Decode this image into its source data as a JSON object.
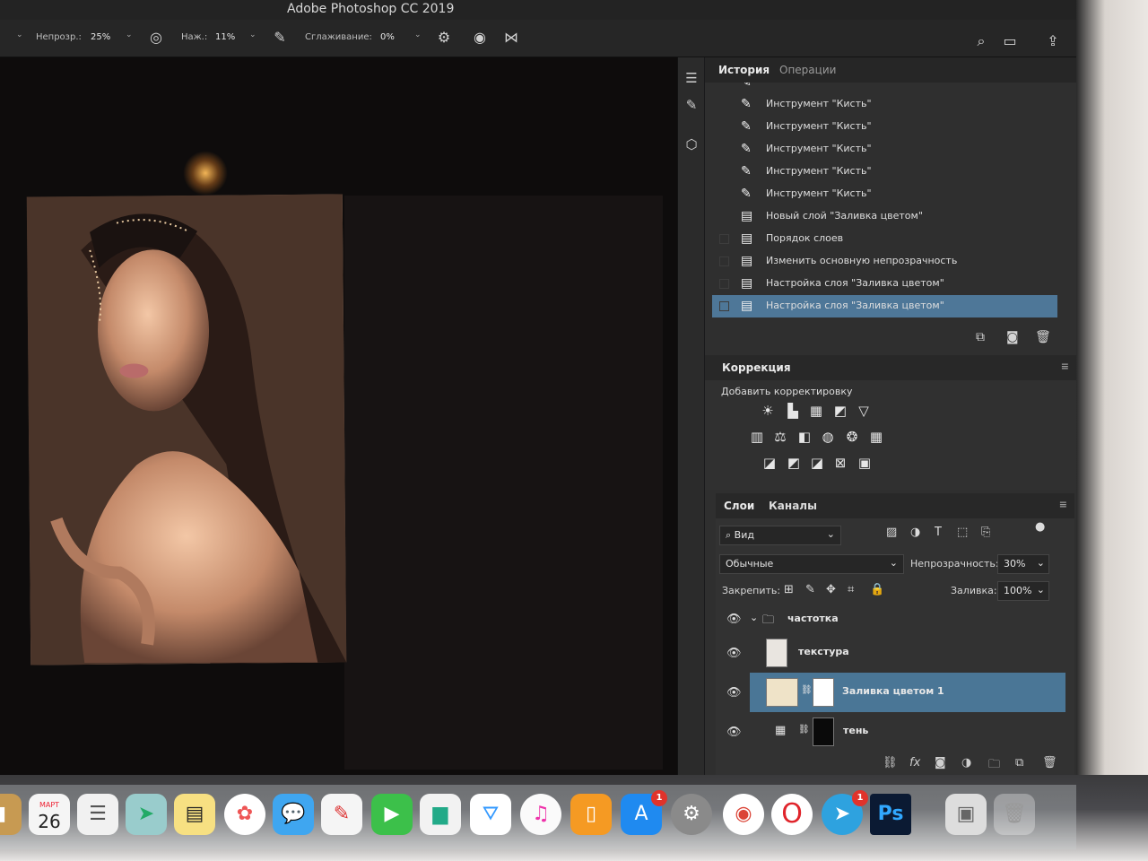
{
  "window": {
    "title": "Adobe Photoshop CC 2019"
  },
  "options_bar": {
    "opacity_label": "Непрозр.:",
    "opacity_value": "25%",
    "pressure_label": "Наж.:",
    "pressure_value": "11%",
    "smoothing_label": "Сглаживание:",
    "smoothing_value": "0%"
  },
  "history_panel": {
    "tabs": [
      {
        "label": "История",
        "active": true
      },
      {
        "label": "Операции",
        "active": false
      }
    ],
    "items": [
      {
        "label": "Инструмент \"Кисть\"",
        "icon": "brush-icon"
      },
      {
        "label": "Инструмент \"Кисть\"",
        "icon": "brush-icon"
      },
      {
        "label": "Инструмент \"Кисть\"",
        "icon": "brush-icon"
      },
      {
        "label": "Инструмент \"Кисть\"",
        "icon": "brush-icon"
      },
      {
        "label": "Инструмент \"Кисть\"",
        "icon": "brush-icon"
      },
      {
        "label": "Инструмент \"Кисть\"",
        "icon": "brush-icon"
      },
      {
        "label": "Новый слой \"Заливка цветом\"",
        "icon": "document-icon"
      },
      {
        "label": "Порядок слоев",
        "icon": "document-icon"
      },
      {
        "label": "Изменить основную непрозрачность",
        "icon": "document-icon"
      },
      {
        "label": "Настройка слоя \"Заливка цветом\"",
        "icon": "document-icon"
      },
      {
        "label": "Настройка слоя \"Заливка цветом\"",
        "icon": "document-icon",
        "selected": true
      }
    ]
  },
  "adjustments_panel": {
    "title": "Коррекция",
    "add_label": "Добавить корректировку"
  },
  "layers_panel": {
    "tabs": [
      {
        "label": "Слои",
        "active": true
      },
      {
        "label": "Каналы",
        "active": false
      }
    ],
    "filter_value": "Вид",
    "blend_mode": "Обычные",
    "opacity_label": "Непрозрачность:",
    "opacity_value": "30%",
    "lock_label": "Закрепить:",
    "fill_label": "Заливка:",
    "fill_value": "100%",
    "layers": [
      {
        "name": "частотка",
        "type": "group",
        "visible": true
      },
      {
        "name": "текстура",
        "type": "pixel",
        "visible": true
      },
      {
        "name": "Заливка цветом 1",
        "type": "fill",
        "visible": true,
        "selected": true,
        "fill_color": "#efe3c8"
      },
      {
        "name": "тень",
        "type": "adjustment",
        "visible": true
      }
    ]
  },
  "dock": {
    "calendar_month": "МАРТ",
    "calendar_day": "26",
    "app_store_badge": "1",
    "telegram_badge": "1",
    "photoshop_label": "Ps"
  },
  "colors": {
    "selection": "#4e7798",
    "panel_bg": "#2f2f2f",
    "fill_swatch": "#efe3c8"
  }
}
